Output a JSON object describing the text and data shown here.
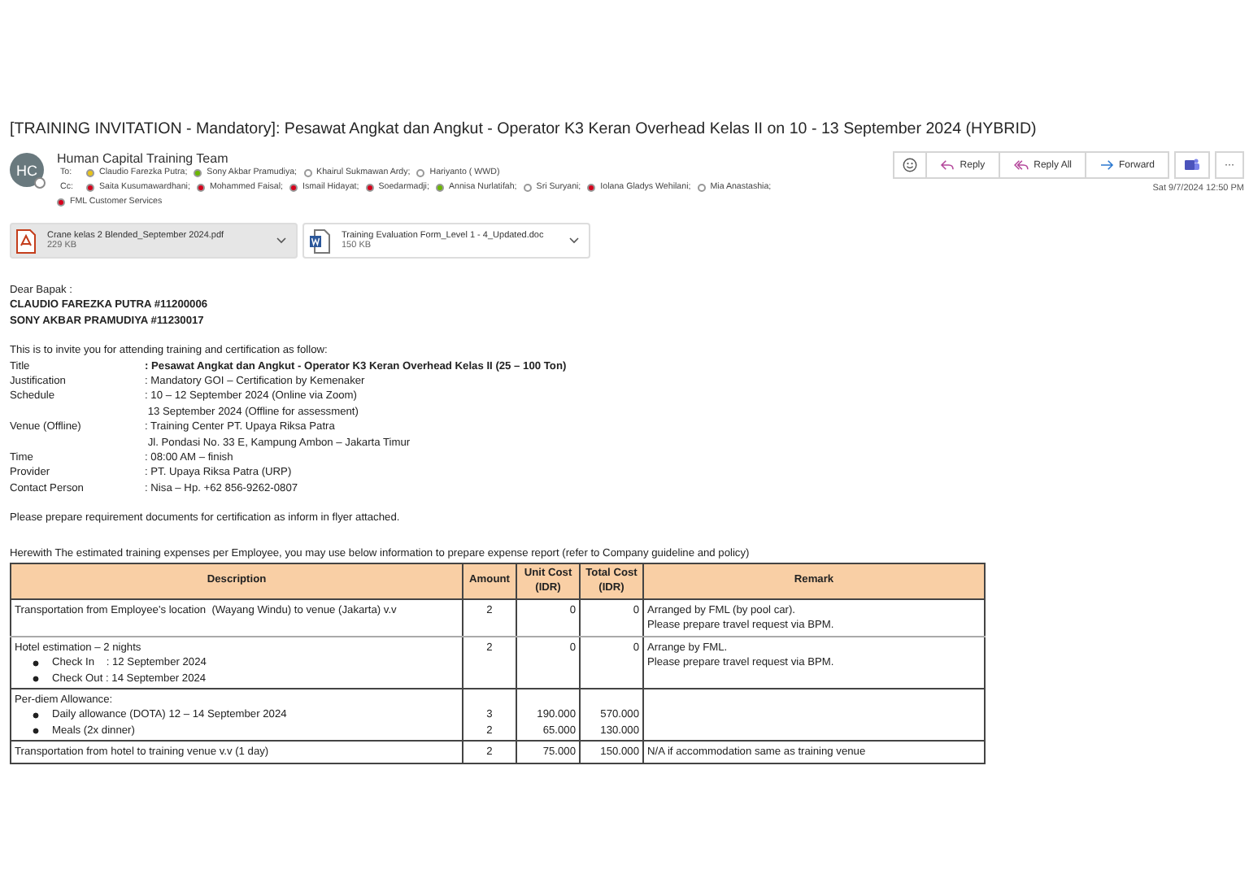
{
  "subject": "[TRAINING INVITATION - Mandatory]: Pesawat Angkat dan Angkut - Operator K3 Keran Overhead Kelas II on 10 - 13 September 2024 (HYBRID)",
  "sender": {
    "initials": "HC",
    "name": "Human Capital Training Team"
  },
  "to_label": "To:",
  "to": [
    {
      "name": "Claudio Farezka Putra;",
      "color": "#e8c31a"
    },
    {
      "name": "Sony Akbar Pramudiya;",
      "color": "#6bb700"
    },
    {
      "name": "Khairul Sukmawan Ardy;",
      "color": "#ffffff"
    },
    {
      "name": "Hariyanto ( WWD)",
      "color": "#ffffff"
    }
  ],
  "cc_label": "Cc:",
  "cc": [
    {
      "name": "Saita Kusumawardhani;",
      "color": "#d6001c"
    },
    {
      "name": "Mohammed Faisal;",
      "color": "#d6001c"
    },
    {
      "name": "Ismail Hidayat;",
      "color": "#d6001c"
    },
    {
      "name": "Soedarmadji;",
      "color": "#d6001c"
    },
    {
      "name": "Annisa Nurlatifah;",
      "color": "#6bb700"
    },
    {
      "name": "Sri Suryani;",
      "color": "#ffffff"
    },
    {
      "name": "Iolana Gladys Wehilani;",
      "color": "#d6001c"
    },
    {
      "name": "Mia Anastashia;",
      "color": "#ffffff"
    },
    {
      "name": "FML Customer Services",
      "color": "#d6001c"
    }
  ],
  "actions": [
    {
      "kind": "emoji"
    },
    {
      "kind": "reply",
      "label": "Reply"
    },
    {
      "kind": "reply_all",
      "label": "Reply All"
    },
    {
      "kind": "forward",
      "label": "Forward"
    },
    {
      "kind": "teams"
    },
    {
      "kind": "more",
      "label": "···"
    }
  ],
  "date": "Sat 9/7/2024 12:50 PM",
  "attachments": [
    {
      "kind": "pdf",
      "name": "Crane kelas 2 Blended_September 2024.pdf",
      "size": "229 KB",
      "selected": true
    },
    {
      "kind": "word",
      "name": "Training Evaluation Form_Level 1 - 4_Updated.doc",
      "size": "150 KB",
      "selected": false
    }
  ],
  "greeting": "Dear Bapak :",
  "recipients_bold": [
    "CLAUDIO FAREZKA PUTRA #11200006",
    "SONY AKBAR PRAMUDIYA #11230017"
  ],
  "intro": "This is to invite you for attending training and certification as follow:",
  "details": [
    {
      "label": "Title",
      "lines": [
        ": Pesawat Angkat dan Angkut - Operator K3 Keran Overhead Kelas II (25 – 100 Ton)"
      ],
      "bold": true
    },
    {
      "label": "Justification",
      "lines": [
        ": Mandatory GOI – Certification by Kemenaker"
      ],
      "bold": false
    },
    {
      "label": "Schedule",
      "lines": [
        ": 10 – 12 September 2024 (Online via Zoom)",
        " 13 September 2024 (Offline for assessment)"
      ],
      "bold": false
    },
    {
      "label": "Venue (Offline)",
      "lines": [
        ": Training Center PT. Upaya Riksa Patra",
        " Jl. Pondasi No. 33 E, Kampung Ambon – Jakarta Timur"
      ],
      "bold": false
    },
    {
      "label": "Time",
      "lines": [
        ": 08:00 AM – finish"
      ],
      "bold": false
    },
    {
      "label": "Provider",
      "lines": [
        ": PT. Upaya Riksa Patra (URP)"
      ],
      "bold": false
    },
    {
      "label": "Contact Person",
      "lines": [
        ": Nisa – Hp. +62 856-9262-0807"
      ],
      "bold": false
    }
  ],
  "note": "Please prepare requirement documents for certification as inform in flyer attached.",
  "expenses_intro": "Herewith The estimated training expenses per Employee, you may use below information to prepare expense report (refer to Company guideline and policy)",
  "table": {
    "columns": [
      "Description",
      "Amount",
      "Unit Cost (IDR)",
      "Total Cost (IDR)",
      "Remark"
    ],
    "rows": [
      {
        "lines": [
          {
            "text": "Transportation from Employee's location  (Wayang Windu) to venue (Jakarta) v.v",
            "bullet": false,
            "amount": "2",
            "unit_cost": "0",
            "total_cost": "0"
          }
        ],
        "remark": [
          "Arranged by FML (by pool car).",
          "Please prepare travel request via BPM."
        ]
      },
      {
        "lines": [
          {
            "text": "Hotel estimation – 2 nights",
            "bullet": false,
            "amount": "2",
            "unit_cost": "0",
            "total_cost": "0"
          },
          {
            "text": "Check In    : 12 September 2024",
            "bullet": true
          },
          {
            "text": "Check Out : 14 September 2024",
            "bullet": true
          }
        ],
        "remark": [
          "Arrange by FML.",
          "Please prepare travel request via BPM."
        ]
      },
      {
        "lines": [
          {
            "text": "Per-diem Allowance:",
            "bullet": false
          },
          {
            "text": "Daily allowance (DOTA) 12 – 14 September 2024",
            "bullet": true,
            "amount": "3",
            "unit_cost": "190.000",
            "total_cost": "570.000"
          },
          {
            "text": "Meals (2x dinner)",
            "bullet": true,
            "amount": "2",
            "unit_cost": "65.000",
            "total_cost": "130.000"
          }
        ],
        "remark": []
      },
      {
        "lines": [
          {
            "text": "Transportation from hotel to training venue v.v (1 day)",
            "bullet": false,
            "amount": "2",
            "unit_cost": "75.000",
            "total_cost": "150.000"
          }
        ],
        "remark": [
          "N/A if accommodation same as training venue"
        ]
      }
    ]
  }
}
